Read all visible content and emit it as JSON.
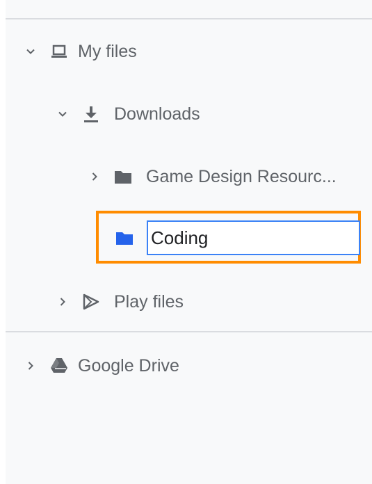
{
  "tree": {
    "my_files": {
      "label": "My files",
      "icon": "laptop-icon",
      "expanded": true
    },
    "downloads": {
      "label": "Downloads",
      "icon": "download-icon",
      "expanded": true
    },
    "game_design": {
      "label": "Game Design Resourc...",
      "icon": "folder-icon"
    },
    "coding": {
      "value": "Coding",
      "icon": "folder-icon",
      "folder_color": "#2563eb",
      "highlight_color": "#ff8c00"
    },
    "play_files": {
      "label": "Play files",
      "icon": "play-store-icon"
    },
    "google_drive": {
      "label": "Google Drive",
      "icon": "google-drive-icon"
    }
  }
}
